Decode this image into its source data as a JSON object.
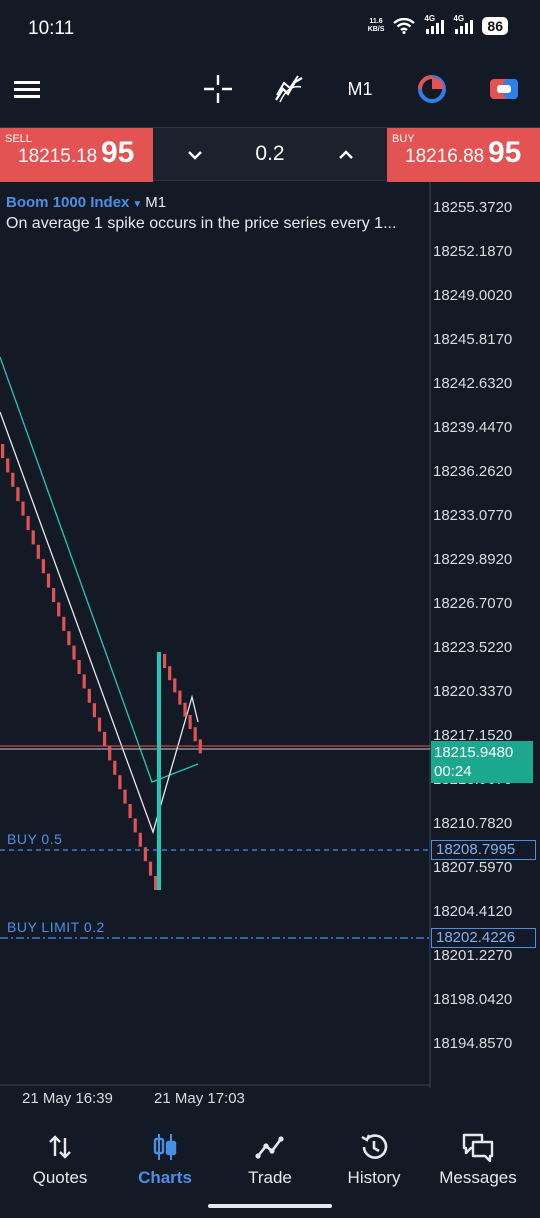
{
  "status_bar": {
    "time": "10:11",
    "net_speed_value": "11.6",
    "net_speed_unit": "KB/S",
    "sim1": "4G",
    "sim2": "4G",
    "battery": "86"
  },
  "toolbar": {
    "timeframe": "M1",
    "icons": [
      "menu-icon",
      "crosshair-icon",
      "indicators-icon",
      "timeframe-label",
      "theme-icon",
      "trade-toggle-icon"
    ]
  },
  "trade_panel": {
    "sell": {
      "tag": "SELL",
      "price_main": "18215.18",
      "price_big": "95"
    },
    "buy": {
      "tag": "BUY",
      "price_main": "18216.88",
      "price_big": "95"
    },
    "volume": "0.2"
  },
  "chart": {
    "symbol": "Boom 1000 Index",
    "timeframe": "M1",
    "description": "On average 1 spike occurs in the price series every 1...",
    "price_axis": [
      "18255.3720",
      "18252.1870",
      "18249.0020",
      "18245.8170",
      "18242.6320",
      "18239.4470",
      "18236.2620",
      "18233.0770",
      "18229.8920",
      "18226.7070",
      "18223.5220",
      "18220.3370",
      "18217.1520",
      "18213.9670",
      "18210.7820",
      "18207.5970",
      "18204.4120",
      "18201.2270",
      "18198.0420",
      "18194.8570"
    ],
    "current_price": "18215.9480",
    "countdown": "00:24",
    "orders": [
      {
        "label": "BUY 0.5",
        "price": "18208.7995"
      },
      {
        "label": "BUY LIMIT 0.2",
        "price": "18202.4226"
      }
    ],
    "time_axis": [
      "21 May 16:39",
      "21 May 17:03"
    ],
    "colors": {
      "bear": "#e35353",
      "bull": "#1ec8b5",
      "order_line": "#4a8fe6",
      "price_line": "#e35353"
    }
  },
  "bottom_nav": {
    "items": [
      {
        "label": "Quotes",
        "icon": "quotes-icon"
      },
      {
        "label": "Charts",
        "icon": "charts-icon",
        "active": true
      },
      {
        "label": "Trade",
        "icon": "trade-icon"
      },
      {
        "label": "History",
        "icon": "history-icon"
      },
      {
        "label": "Messages",
        "icon": "messages-icon"
      }
    ]
  }
}
